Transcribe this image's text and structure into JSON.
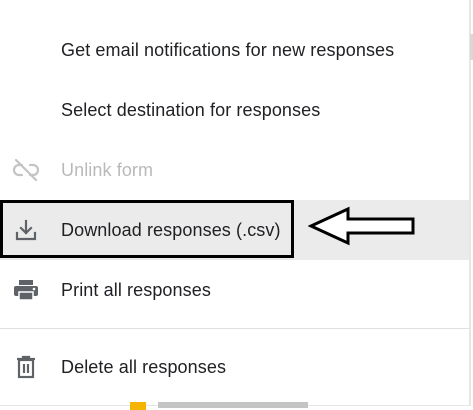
{
  "menu": {
    "items": [
      {
        "label": "Get email notifications for new responses",
        "icon": "none",
        "disabled": false,
        "highlighted": false
      },
      {
        "label": "Select destination for responses",
        "icon": "none",
        "disabled": false,
        "highlighted": false
      },
      {
        "label": "Unlink form",
        "icon": "unlink-icon",
        "disabled": true,
        "highlighted": false
      },
      {
        "label": "Download responses (.csv)",
        "icon": "download-icon",
        "disabled": false,
        "highlighted": true
      },
      {
        "label": "Print all responses",
        "icon": "print-icon",
        "disabled": false,
        "highlighted": false
      },
      {
        "label": "Delete all responses",
        "icon": "trash-icon",
        "disabled": false,
        "highlighted": false
      }
    ]
  },
  "annotation": {
    "type": "box-and-arrow",
    "target": "Download responses (.csv)"
  },
  "colors": {
    "text": "#202124",
    "disabled_text": "#b9b9b9",
    "icon": "#5f6368",
    "highlight_bg": "#ebebeb",
    "annotation": "#000000"
  }
}
